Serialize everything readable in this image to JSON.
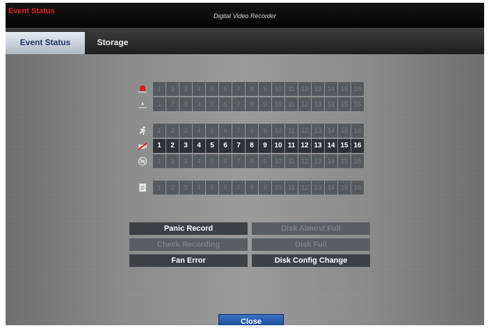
{
  "titlebar": {
    "app_name": "Event Status",
    "window_title": "Digital Video Recorder"
  },
  "tabs": [
    {
      "label": "Event Status",
      "active": true
    },
    {
      "label": "Storage",
      "active": false
    }
  ],
  "channels": [
    "1",
    "2",
    "3",
    "4",
    "5",
    "6",
    "7",
    "8",
    "9",
    "10",
    "11",
    "12",
    "13",
    "14",
    "15",
    "16"
  ],
  "event_rows": [
    {
      "name": "alarm-in",
      "icon": "alarm-light-icon",
      "active": false
    },
    {
      "name": "alarm-out",
      "icon": "alarm-out-icon",
      "active": false
    },
    {
      "name": "motion",
      "icon": "motion-running-man-icon",
      "active": false
    },
    {
      "name": "video-loss",
      "icon": "video-loss-camera-icon",
      "active": true
    },
    {
      "name": "tampering",
      "icon": "tampering-icon",
      "active": false
    },
    {
      "name": "text-in",
      "icon": "text-in-document-icon",
      "active": false
    }
  ],
  "status_buttons": {
    "panic_record": {
      "label": "Panic Record",
      "active": true
    },
    "disk_almost_full": {
      "label": "Disk Almost Full",
      "active": false
    },
    "check_recording": {
      "label": "Check Recording",
      "active": false
    },
    "disk_full": {
      "label": "Disk Full",
      "active": false
    },
    "fan_error": {
      "label": "Fan Error",
      "active": true
    },
    "disk_config_change": {
      "label": "Disk Config Change",
      "active": true
    }
  },
  "close_label": "Close",
  "colors": {
    "accent_red": "#e0201b",
    "tab_active_text": "#1d3568",
    "close_button": "#2a5aa8"
  }
}
